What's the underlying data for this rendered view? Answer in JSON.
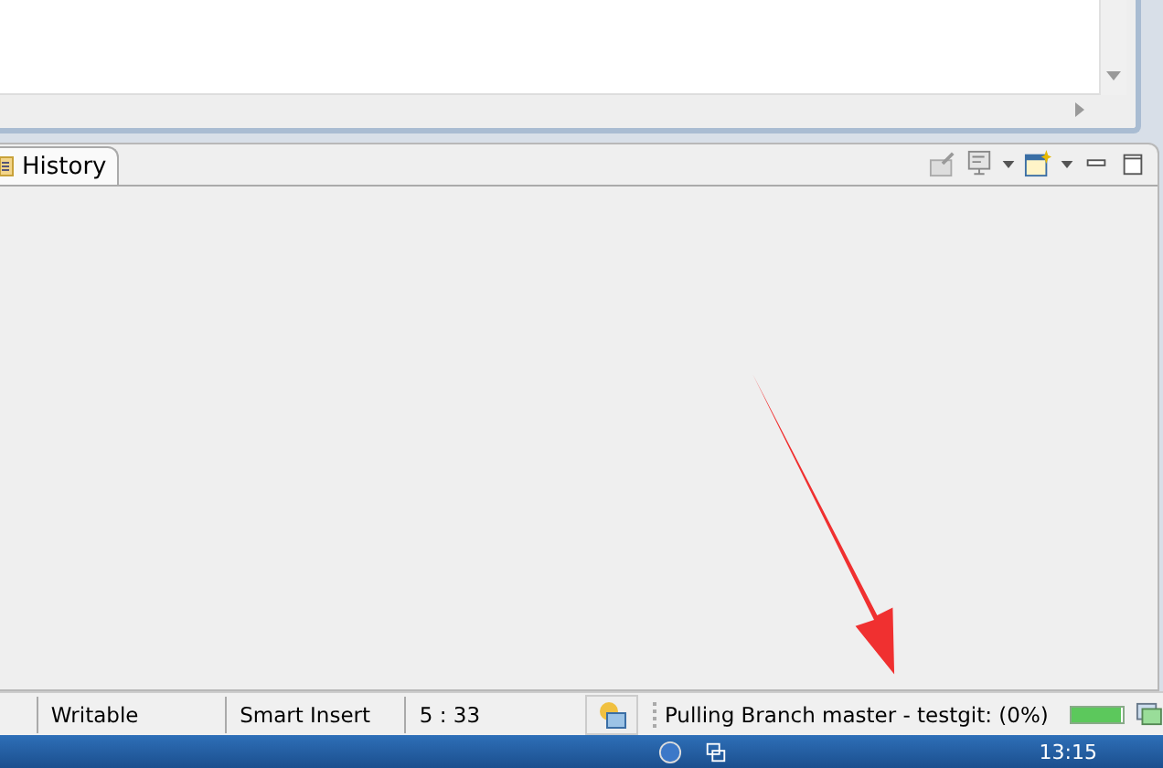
{
  "view_tabs": [
    {
      "label": "History",
      "selected": true
    }
  ],
  "status_bar": {
    "fields": [
      "Writable",
      "Smart Insert",
      "5 : 33"
    ],
    "progress_text": "Pulling Branch master - testgit: (0%)",
    "progress": {
      "level": 0.95
    }
  },
  "taskbar": {
    "clock": "13:15"
  }
}
